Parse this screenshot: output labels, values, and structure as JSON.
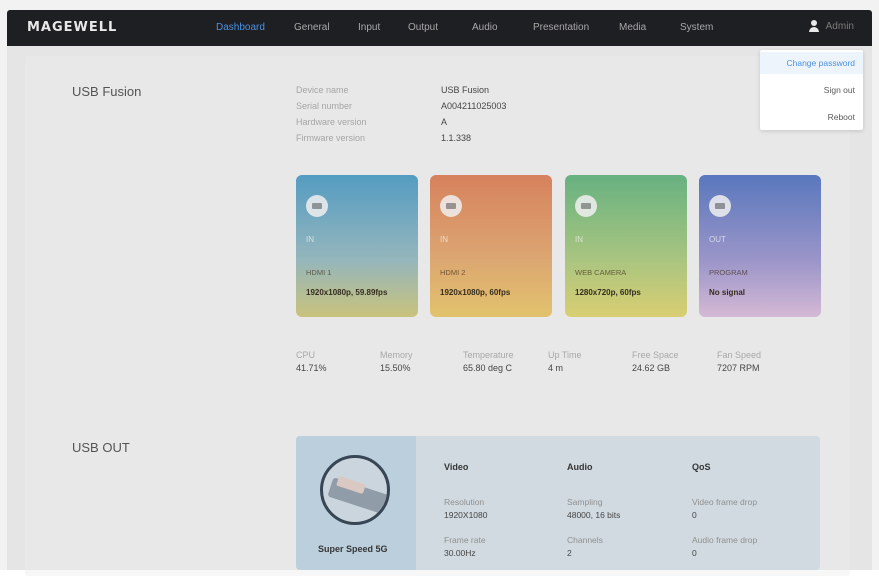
{
  "brand": {
    "logo": "MAGEWELL"
  },
  "nav": {
    "items": [
      "Dashboard",
      "General",
      "Input",
      "Output",
      "Audio",
      "Presentation",
      "Media",
      "System"
    ],
    "active": "Dashboard",
    "user": "Admin"
  },
  "dropdown": {
    "items": [
      "Change password",
      "Sign out",
      "Reboot"
    ]
  },
  "device": {
    "section_title": "USB Fusion",
    "info": [
      {
        "key": "Device name",
        "value": "USB Fusion"
      },
      {
        "key": "Serial number",
        "value": "A004211025003"
      },
      {
        "key": "Hardware version",
        "value": "A"
      },
      {
        "key": "Firmware version",
        "value": "1.1.338"
      }
    ],
    "cards": [
      {
        "direction": "IN",
        "port": "HDMI 1",
        "signal": "1920x1080p, 59.89fps"
      },
      {
        "direction": "IN",
        "port": "HDMI 2",
        "signal": "1920x1080p, 60fps"
      },
      {
        "direction": "IN",
        "port": "WEB CAMERA",
        "signal": "1280x720p, 60fps"
      },
      {
        "direction": "OUT",
        "port": "PROGRAM",
        "signal": "No signal"
      }
    ],
    "stats": [
      {
        "key": "CPU",
        "value": "41.71%"
      },
      {
        "key": "Memory",
        "value": "15.50%"
      },
      {
        "key": "Temperature",
        "value": "65.80 deg C"
      },
      {
        "key": "Up Time",
        "value": "4 m"
      },
      {
        "key": "Free Space",
        "value": "24.62 GB"
      },
      {
        "key": "Fan Speed",
        "value": "7207 RPM"
      }
    ]
  },
  "usb_out": {
    "section_title": "USB OUT",
    "badge": "Super Speed 5G",
    "columns": [
      {
        "title": "Video",
        "items": [
          {
            "key": "Resolution",
            "value": "1920X1080"
          },
          {
            "key": "Frame rate",
            "value": "30.00Hz"
          }
        ]
      },
      {
        "title": "Audio",
        "items": [
          {
            "key": "Sampling",
            "value": "48000, 16 bits"
          },
          {
            "key": "Channels",
            "value": "2"
          }
        ]
      },
      {
        "title": "QoS",
        "items": [
          {
            "key": "Video frame drop",
            "value": "0"
          },
          {
            "key": "Audio frame drop",
            "value": "0"
          }
        ]
      }
    ]
  }
}
